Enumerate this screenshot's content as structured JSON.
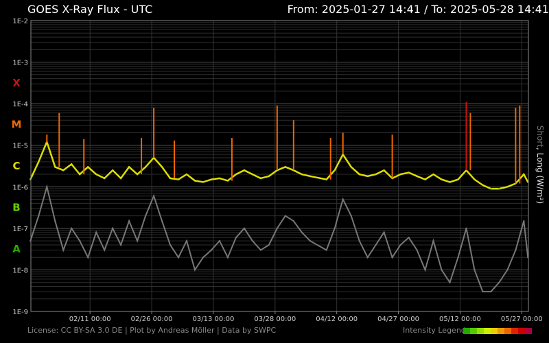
{
  "header": {
    "title": "GOES X-Ray Flux - UTC",
    "range": "From: 2025-01-27 14:41  /  To: 2025-05-28 14:41"
  },
  "footer": {
    "license": "License: CC BY-SA 3.0 DE | Plot by Andreas Möller | Data by SWPC",
    "legend_label": "Intensity Legend",
    "legend_colors": [
      "#22aa00",
      "#55cc00",
      "#99dd00",
      "#ccee00",
      "#eecc00",
      "#ee9900",
      "#ee6600",
      "#dd2200",
      "#cc0000",
      "#aa0044"
    ]
  },
  "chart_data": {
    "type": "line",
    "title": "GOES X-Ray Flux - UTC",
    "ylabel_short": "Short",
    "ylabel_sep": ", ",
    "ylabel_long": "Long (W/m²)",
    "yscale": "log",
    "ylim": [
      1e-09,
      0.01
    ],
    "y_ticks": [
      "1E-2",
      "1E-3",
      "1E-4",
      "1E-5",
      "1E-6",
      "1E-7",
      "1E-8",
      "1E-9"
    ],
    "x_range": [
      "2025-01-27 14:41",
      "2025-05-28 14:41"
    ],
    "x_ticks": [
      {
        "date": "2025-02-11",
        "label": "02/11 00:00"
      },
      {
        "date": "2025-02-26",
        "label": "02/26 00:00"
      },
      {
        "date": "2025-03-13",
        "label": "03/13 00:00"
      },
      {
        "date": "2025-03-28",
        "label": "03/28 00:00"
      },
      {
        "date": "2025-04-12",
        "label": "04/12 00:00"
      },
      {
        "date": "2025-04-27",
        "label": "04/27 00:00"
      },
      {
        "date": "2025-05-12",
        "label": "05/12 00:00"
      },
      {
        "date": "2025-05-27",
        "label": "05/27 00:00"
      }
    ],
    "flare_classes": [
      {
        "label": "X",
        "color": "#cc1111"
      },
      {
        "label": "M",
        "color": "#ee6600"
      },
      {
        "label": "C",
        "color": "#dddd00"
      },
      {
        "label": "B",
        "color": "#66cc00"
      },
      {
        "label": "A",
        "color": "#22aa00"
      }
    ],
    "grid": true,
    "series": [
      {
        "name": "Long",
        "color": "#dddd00",
        "values": [
          [
            "2025-01-27",
            1.5e-06
          ],
          [
            "2025-01-29",
            4e-06
          ],
          [
            "2025-01-31",
            1.2e-05
          ],
          [
            "2025-02-02",
            3e-06
          ],
          [
            "2025-02-04",
            2.5e-06
          ],
          [
            "2025-02-06",
            3.5e-06
          ],
          [
            "2025-02-08",
            2e-06
          ],
          [
            "2025-02-10",
            3e-06
          ],
          [
            "2025-02-12",
            2e-06
          ],
          [
            "2025-02-14",
            1.6e-06
          ],
          [
            "2025-02-16",
            2.5e-06
          ],
          [
            "2025-02-18",
            1.6e-06
          ],
          [
            "2025-02-20",
            3e-06
          ],
          [
            "2025-02-22",
            2e-06
          ],
          [
            "2025-02-24",
            3e-06
          ],
          [
            "2025-02-26",
            5e-06
          ],
          [
            "2025-02-28",
            3e-06
          ],
          [
            "2025-03-02",
            1.6e-06
          ],
          [
            "2025-03-04",
            1.5e-06
          ],
          [
            "2025-03-06",
            2e-06
          ],
          [
            "2025-03-08",
            1.4e-06
          ],
          [
            "2025-03-10",
            1.3e-06
          ],
          [
            "2025-03-12",
            1.5e-06
          ],
          [
            "2025-03-14",
            1.6e-06
          ],
          [
            "2025-03-16",
            1.4e-06
          ],
          [
            "2025-03-18",
            2e-06
          ],
          [
            "2025-03-20",
            2.5e-06
          ],
          [
            "2025-03-22",
            2e-06
          ],
          [
            "2025-03-24",
            1.6e-06
          ],
          [
            "2025-03-26",
            1.8e-06
          ],
          [
            "2025-03-28",
            2.5e-06
          ],
          [
            "2025-03-30",
            3e-06
          ],
          [
            "2025-04-01",
            2.5e-06
          ],
          [
            "2025-04-03",
            2e-06
          ],
          [
            "2025-04-05",
            1.8e-06
          ],
          [
            "2025-04-09",
            1.5e-06
          ],
          [
            "2025-04-11",
            2.5e-06
          ],
          [
            "2025-04-13",
            6e-06
          ],
          [
            "2025-04-15",
            3e-06
          ],
          [
            "2025-04-17",
            2e-06
          ],
          [
            "2025-04-19",
            1.8e-06
          ],
          [
            "2025-04-21",
            2e-06
          ],
          [
            "2025-04-23",
            2.5e-06
          ],
          [
            "2025-04-25",
            1.6e-06
          ],
          [
            "2025-04-27",
            2e-06
          ],
          [
            "2025-04-29",
            2.2e-06
          ],
          [
            "2025-05-01",
            1.8e-06
          ],
          [
            "2025-05-03",
            1.5e-06
          ],
          [
            "2025-05-05",
            2e-06
          ],
          [
            "2025-05-07",
            1.5e-06
          ],
          [
            "2025-05-09",
            1.3e-06
          ],
          [
            "2025-05-11",
            1.5e-06
          ],
          [
            "2025-05-13",
            2.5e-06
          ],
          [
            "2025-05-15",
            1.5e-06
          ],
          [
            "2025-05-17",
            1.1e-06
          ],
          [
            "2025-05-19",
            9e-07
          ],
          [
            "2025-05-21",
            9e-07
          ],
          [
            "2025-05-23",
            1e-06
          ],
          [
            "2025-05-25",
            1.2e-06
          ],
          [
            "2025-05-27",
            2e-06
          ],
          [
            "2025-05-28",
            1.3e-06
          ]
        ]
      },
      {
        "name": "Short",
        "color": "#777777",
        "values": [
          [
            "2025-01-27",
            5e-08
          ],
          [
            "2025-01-29",
            2e-07
          ],
          [
            "2025-01-31",
            1e-06
          ],
          [
            "2025-02-02",
            1.5e-07
          ],
          [
            "2025-02-04",
            3e-08
          ],
          [
            "2025-02-06",
            1e-07
          ],
          [
            "2025-02-08",
            5e-08
          ],
          [
            "2025-02-10",
            2e-08
          ],
          [
            "2025-02-12",
            8e-08
          ],
          [
            "2025-02-14",
            3e-08
          ],
          [
            "2025-02-16",
            1e-07
          ],
          [
            "2025-02-18",
            4e-08
          ],
          [
            "2025-02-20",
            1.5e-07
          ],
          [
            "2025-02-22",
            5e-08
          ],
          [
            "2025-02-24",
            2e-07
          ],
          [
            "2025-02-26",
            6e-07
          ],
          [
            "2025-02-28",
            1.5e-07
          ],
          [
            "2025-03-02",
            4e-08
          ],
          [
            "2025-03-04",
            2e-08
          ],
          [
            "2025-03-06",
            5e-08
          ],
          [
            "2025-03-08",
            1e-08
          ],
          [
            "2025-03-10",
            2e-08
          ],
          [
            "2025-03-12",
            3e-08
          ],
          [
            "2025-03-14",
            5e-08
          ],
          [
            "2025-03-16",
            2e-08
          ],
          [
            "2025-03-18",
            6e-08
          ],
          [
            "2025-03-20",
            1e-07
          ],
          [
            "2025-03-22",
            5e-08
          ],
          [
            "2025-03-24",
            3e-08
          ],
          [
            "2025-03-26",
            4e-08
          ],
          [
            "2025-03-28",
            1e-07
          ],
          [
            "2025-03-30",
            2e-07
          ],
          [
            "2025-04-01",
            1.5e-07
          ],
          [
            "2025-04-03",
            8e-08
          ],
          [
            "2025-04-05",
            5e-08
          ],
          [
            "2025-04-09",
            3e-08
          ],
          [
            "2025-04-11",
            1e-07
          ],
          [
            "2025-04-13",
            5e-07
          ],
          [
            "2025-04-15",
            2e-07
          ],
          [
            "2025-04-17",
            5e-08
          ],
          [
            "2025-04-19",
            2e-08
          ],
          [
            "2025-04-21",
            4e-08
          ],
          [
            "2025-04-23",
            8e-08
          ],
          [
            "2025-04-25",
            2e-08
          ],
          [
            "2025-04-27",
            4e-08
          ],
          [
            "2025-04-29",
            6e-08
          ],
          [
            "2025-05-01",
            3e-08
          ],
          [
            "2025-05-03",
            1e-08
          ],
          [
            "2025-05-05",
            5e-08
          ],
          [
            "2025-05-07",
            1e-08
          ],
          [
            "2025-05-09",
            5e-09
          ],
          [
            "2025-05-11",
            2e-08
          ],
          [
            "2025-05-13",
            1e-07
          ],
          [
            "2025-05-15",
            1e-08
          ],
          [
            "2025-05-17",
            3e-09
          ],
          [
            "2025-05-19",
            3e-09
          ],
          [
            "2025-05-21",
            5e-09
          ],
          [
            "2025-05-23",
            1e-08
          ],
          [
            "2025-05-25",
            3e-08
          ],
          [
            "2025-05-27",
            1.5e-07
          ],
          [
            "2025-05-28",
            2e-08
          ]
        ]
      }
    ],
    "flares": [
      {
        "date": "2025-01-31",
        "peak": 1.8e-05
      },
      {
        "date": "2025-02-03",
        "peak": 6e-05
      },
      {
        "date": "2025-02-09",
        "peak": 1.4e-05
      },
      {
        "date": "2025-02-23",
        "peak": 1.5e-05
      },
      {
        "date": "2025-02-26",
        "peak": 8e-05
      },
      {
        "date": "2025-03-03",
        "peak": 1.3e-05
      },
      {
        "date": "2025-03-17",
        "peak": 1.5e-05
      },
      {
        "date": "2025-03-28",
        "peak": 9e-05
      },
      {
        "date": "2025-04-01",
        "peak": 4e-05
      },
      {
        "date": "2025-04-10",
        "peak": 1.5e-05
      },
      {
        "date": "2025-04-13",
        "peak": 2e-05
      },
      {
        "date": "2025-04-25",
        "peak": 1.8e-05
      },
      {
        "date": "2025-05-13",
        "peak": 0.00011
      },
      {
        "date": "2025-05-14",
        "peak": 6e-05
      },
      {
        "date": "2025-05-25",
        "peak": 8e-05
      },
      {
        "date": "2025-05-26",
        "peak": 9e-05
      }
    ]
  }
}
